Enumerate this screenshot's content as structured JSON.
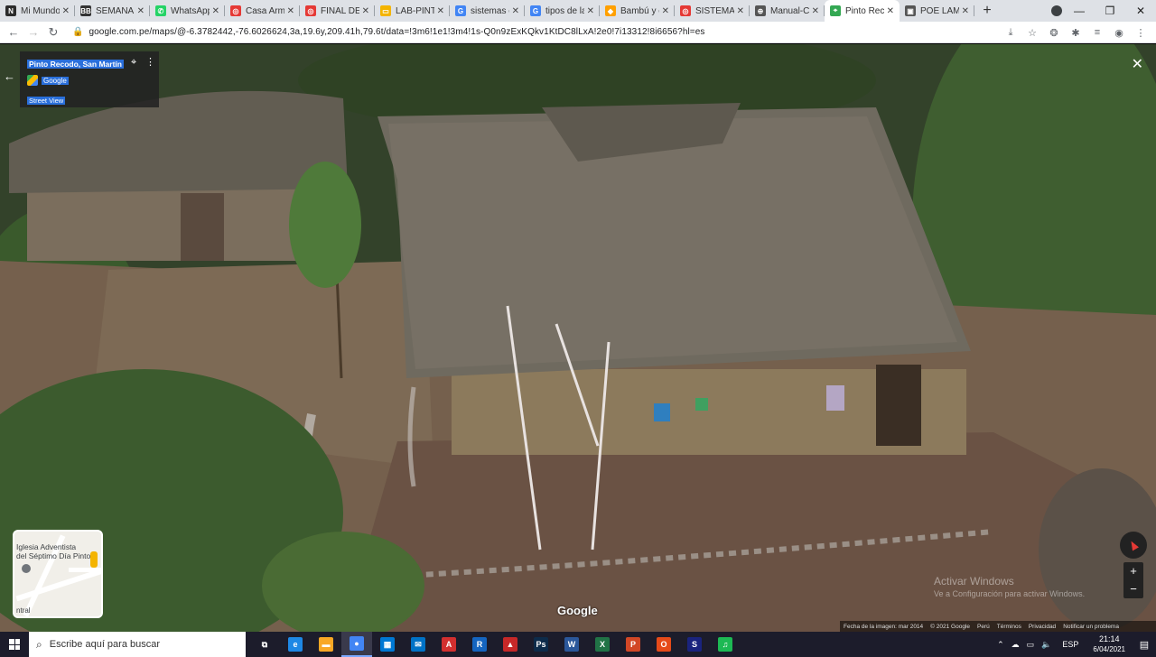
{
  "browser": {
    "tabs": [
      {
        "title": "Mi Mundo",
        "color": "#2b2b2b",
        "glyph": "N"
      },
      {
        "title": "SEMANA 2",
        "color": "#333333",
        "glyph": "BB"
      },
      {
        "title": "WhatsApp",
        "color": "#25d366",
        "glyph": "✆"
      },
      {
        "title": "Casa Arm",
        "color": "#e53935",
        "glyph": "◎"
      },
      {
        "title": "FINAL DE",
        "color": "#e53935",
        "glyph": "◎"
      },
      {
        "title": "LAB-PINT",
        "color": "#f4b400",
        "glyph": "▭"
      },
      {
        "title": "sistemas c",
        "color": "#4285f4",
        "glyph": "G"
      },
      {
        "title": "tipos de la",
        "color": "#4285f4",
        "glyph": "G"
      },
      {
        "title": "Bambú y c",
        "color": "#ffa000",
        "glyph": "◆"
      },
      {
        "title": "SISTEMA C",
        "color": "#e53935",
        "glyph": "◎"
      },
      {
        "title": "Manual-C",
        "color": "#555555",
        "glyph": "⊕"
      },
      {
        "title": "Pinto Reco",
        "color": "#34a853",
        "glyph": "⌖",
        "active": true
      },
      {
        "title": "POE LAMA",
        "color": "#555555",
        "glyph": "▣"
      }
    ],
    "new_tab": "+",
    "url": "google.com.pe/maps/@-6.3782442,-76.6026624,3a,19.6y,209.41h,79.6t/data=!3m6!1e1!3m4!1s-Q0n9zExKQkv1KtDC8lLxA!2e0!7i13312!8i6656?hl=es"
  },
  "streetview": {
    "place_name": "Pinto Recodo, San Martín",
    "brand": "Google",
    "mode": "Street View",
    "close": "✕",
    "google_logo": "Google",
    "watermark_title": "Activar Windows",
    "watermark_sub": "Ve a Configuración para activar Windows.",
    "footer": [
      "Fecha de la imagen: mar 2014",
      "© 2021 Google",
      "Perú",
      "Términos",
      "Privacidad",
      "Notificar un problema"
    ],
    "minimap": {
      "label_line1": "Iglesia Adventista",
      "label_line2": "del Séptimo Día Pinto",
      "bottom": "ntral"
    },
    "zoom_in": "+",
    "zoom_out": "−"
  },
  "taskbar": {
    "search_placeholder": "Escribe aquí para buscar",
    "apps": [
      {
        "name": "task-view",
        "color": "transparent",
        "glyph": "⧉"
      },
      {
        "name": "edge",
        "color": "#1e88e5",
        "glyph": "e"
      },
      {
        "name": "file-explorer",
        "color": "#f9a825",
        "glyph": "▬"
      },
      {
        "name": "chrome",
        "color": "#4285f4",
        "glyph": "●",
        "active": true
      },
      {
        "name": "store",
        "color": "#0078d4",
        "glyph": "▦"
      },
      {
        "name": "mail",
        "color": "#0072c6",
        "glyph": "✉"
      },
      {
        "name": "acrobat",
        "color": "#d32f2f",
        "glyph": "A"
      },
      {
        "name": "revit",
        "color": "#1565c0",
        "glyph": "R"
      },
      {
        "name": "autocad",
        "color": "#c62828",
        "glyph": "▲"
      },
      {
        "name": "photoshop",
        "color": "#0d2b4a",
        "glyph": "Ps"
      },
      {
        "name": "word",
        "color": "#2b579a",
        "glyph": "W"
      },
      {
        "name": "excel",
        "color": "#217346",
        "glyph": "X"
      },
      {
        "name": "powerpoint",
        "color": "#d24726",
        "glyph": "P"
      },
      {
        "name": "office",
        "color": "#e64a19",
        "glyph": "O"
      },
      {
        "name": "sketchup",
        "color": "#1a237e",
        "glyph": "S"
      },
      {
        "name": "spotify",
        "color": "#1db954",
        "glyph": "♫"
      }
    ],
    "language": "ESP",
    "time": "21:14",
    "date": "6/04/2021"
  }
}
